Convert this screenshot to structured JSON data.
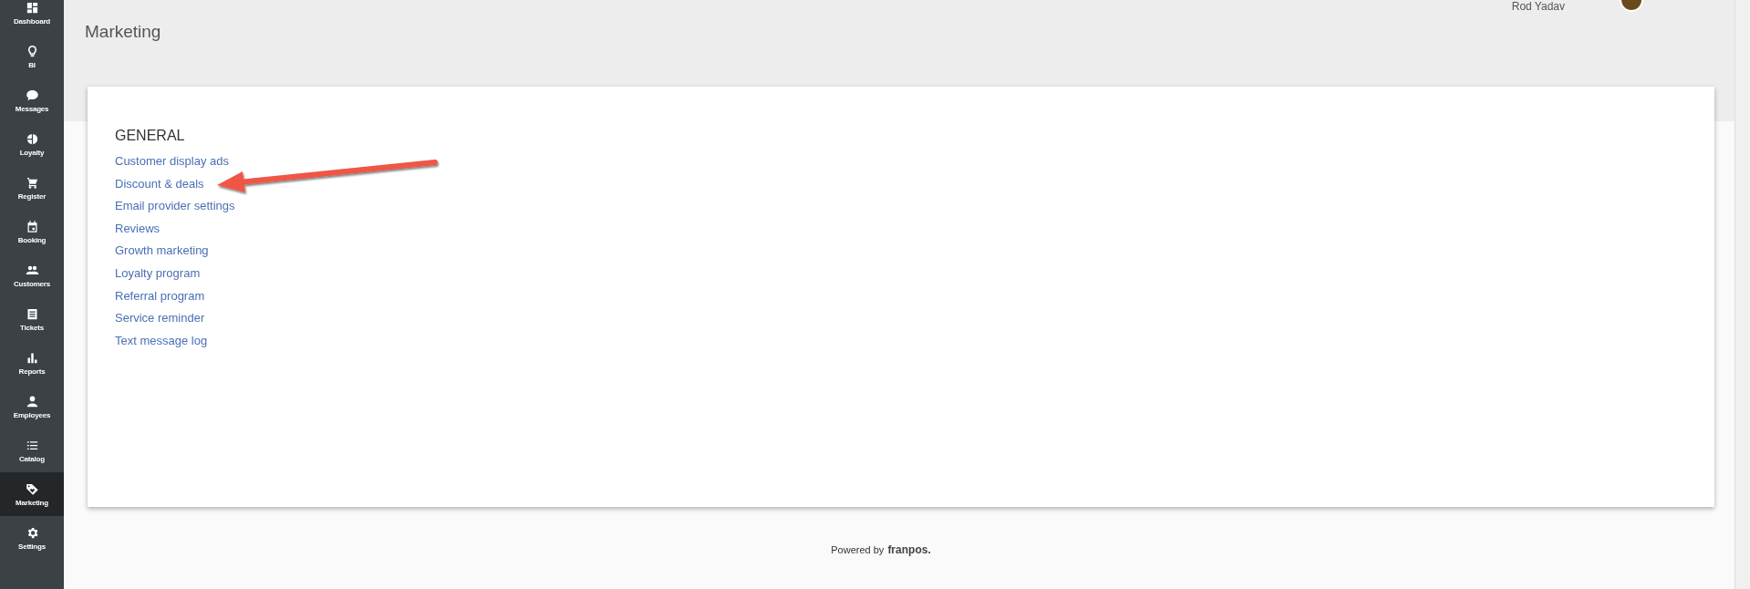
{
  "sidebar": {
    "items": [
      {
        "label": "Dashboard",
        "selected": false
      },
      {
        "label": "BI",
        "selected": false
      },
      {
        "label": "Messages",
        "selected": false
      },
      {
        "label": "Loyalty",
        "selected": false
      },
      {
        "label": "Register",
        "selected": false
      },
      {
        "label": "Booking",
        "selected": false
      },
      {
        "label": "Customers",
        "selected": false
      },
      {
        "label": "Tickets",
        "selected": false
      },
      {
        "label": "Reports",
        "selected": false
      },
      {
        "label": "Employees",
        "selected": false
      },
      {
        "label": "Catalog",
        "selected": false
      },
      {
        "label": "Marketing",
        "selected": true
      },
      {
        "label": "Settings",
        "selected": false
      }
    ]
  },
  "user": {
    "name": "Rod Yadav"
  },
  "page": {
    "title": "Marketing"
  },
  "section": {
    "heading": "GENERAL",
    "links": [
      "Customer display ads",
      "Discount & deals",
      "Email provider settings",
      "Reviews",
      "Growth marketing",
      "Loyalty program",
      "Referral program",
      "Service reminder",
      "Text message log"
    ]
  },
  "footer": {
    "text": "Powered by",
    "brand": "franpos."
  }
}
